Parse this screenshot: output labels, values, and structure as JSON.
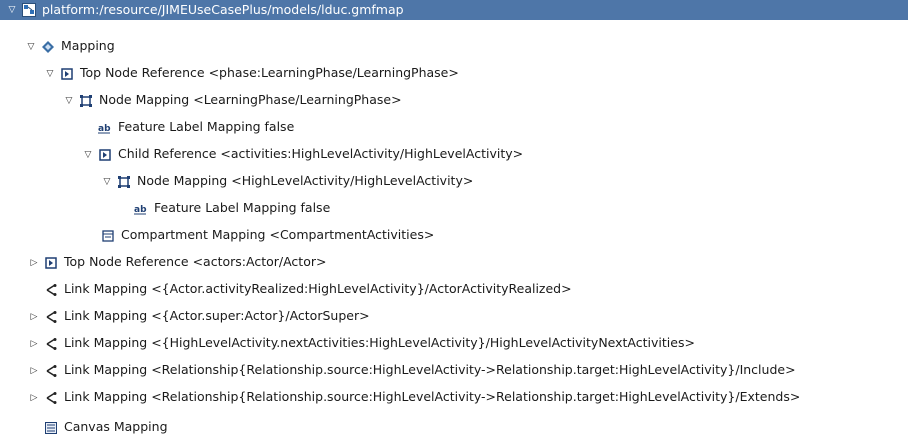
{
  "tree": {
    "root": {
      "label": "platform:/resource/JIMEUseCasePlus/models/lduc.gmfmap",
      "expanded": true,
      "icon": "gmfmap-file-icon"
    },
    "mapping": {
      "label": "Mapping",
      "expanded": true,
      "icon": "mapping-icon"
    },
    "top_node_1": {
      "label": "Top Node Reference <phase:LearningPhase/LearningPhase>",
      "expanded": true,
      "icon": "top-node-reference-icon"
    },
    "node_mapping_1": {
      "label": "Node Mapping <LearningPhase/LearningPhase>",
      "expanded": true,
      "icon": "node-mapping-icon"
    },
    "feature_label_1": {
      "label": "Feature Label Mapping false",
      "icon": "feature-label-icon"
    },
    "child_ref": {
      "label": "Child Reference <activities:HighLevelActivity/HighLevelActivity>",
      "expanded": true,
      "icon": "child-reference-icon"
    },
    "node_mapping_2": {
      "label": "Node Mapping <HighLevelActivity/HighLevelActivity>",
      "expanded": true,
      "icon": "node-mapping-icon"
    },
    "feature_label_2": {
      "label": "Feature Label Mapping false",
      "icon": "feature-label-icon"
    },
    "compartment": {
      "label": "Compartment Mapping <CompartmentActivities>",
      "icon": "compartment-icon"
    },
    "top_node_2": {
      "label": "Top Node Reference <actors:Actor/Actor>",
      "expanded": false,
      "icon": "top-node-reference-icon"
    },
    "link_1": {
      "label": "Link Mapping <{Actor.activityRealized:HighLevelActivity}/ActorActivityRealized>",
      "icon": "link-mapping-icon"
    },
    "link_2": {
      "label": "Link Mapping <{Actor.super:Actor}/ActorSuper>",
      "expanded": false,
      "icon": "link-mapping-icon"
    },
    "link_3": {
      "label": "Link Mapping <{HighLevelActivity.nextActivities:HighLevelActivity}/HighLevelActivityNextActivities>",
      "expanded": false,
      "icon": "link-mapping-icon"
    },
    "link_4": {
      "label": "Link Mapping <Relationship{Relationship.source:HighLevelActivity->Relationship.target:HighLevelActivity}/Include>",
      "expanded": false,
      "icon": "link-mapping-icon"
    },
    "link_5": {
      "label": "Link Mapping <Relationship{Relationship.source:HighLevelActivity->Relationship.target:HighLevelActivity}/Extends>",
      "expanded": false,
      "icon": "link-mapping-icon"
    },
    "canvas": {
      "label": "Canvas Mapping",
      "icon": "canvas-mapping-icon"
    }
  },
  "colors": {
    "selection": "#4e76a8",
    "mapping_icon": "#3a6ea5",
    "link_icon": "#222222"
  }
}
